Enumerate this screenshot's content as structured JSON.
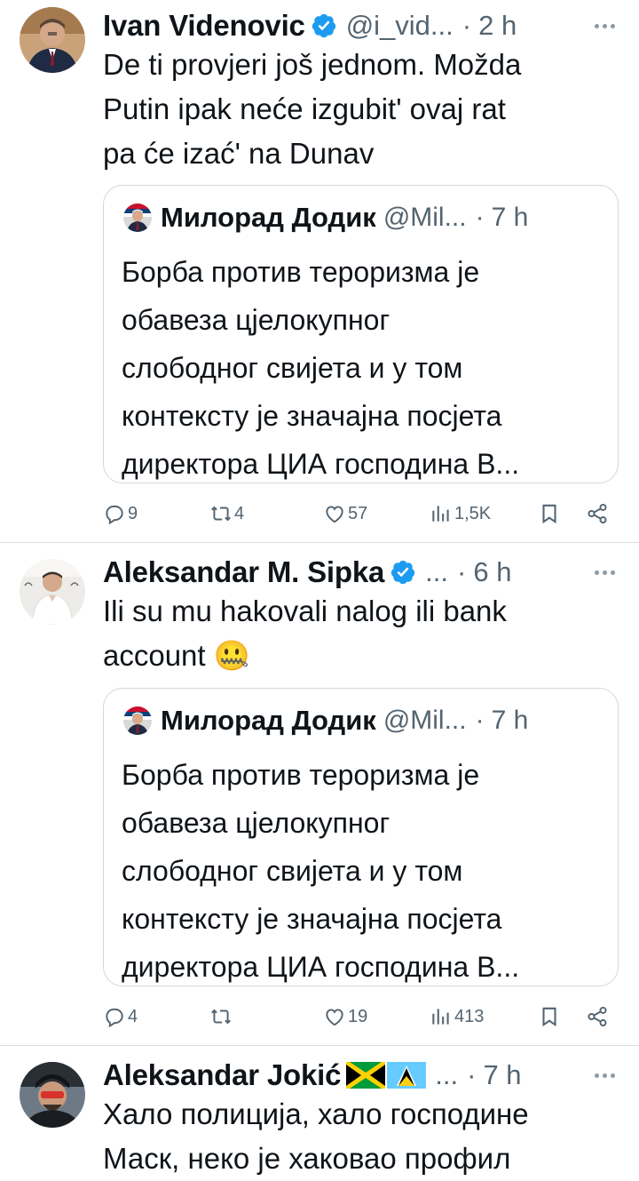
{
  "tweets": [
    {
      "author": "Ivan Videnovic",
      "handle": "@i_vid...",
      "dot": "·",
      "time": "2 h",
      "lines": [
        "De ti provjeri još jednom. Možda",
        "Putin ipak neće izgubit' ovaj rat",
        "pa će izać' na Dunav"
      ],
      "quote": {
        "author": "Милорад Додик",
        "handle": "@Mil...",
        "dot": "·",
        "time": "7 h",
        "lines": [
          "Борба против тероризма је",
          "обавеза цјелокупног",
          "слободног свијета и у том",
          "контексту је значајна посјета",
          "директора ЦИА господина В..."
        ]
      },
      "actions": {
        "replies": "9",
        "reposts": "4",
        "likes": "57",
        "views": "1,5K"
      }
    },
    {
      "author": "Aleksandar M. Sipka",
      "handle": "...",
      "dot": "·",
      "time": "6 h",
      "lines": [
        "Ili su mu hakovali nalog ili bank",
        "account"
      ],
      "emoji": "🤐",
      "quote": {
        "author": "Милорад Додик",
        "handle": "@Mil...",
        "dot": "·",
        "time": "7 h",
        "lines": [
          "Борба против тероризма је",
          "обавеза цјелокупног",
          "слободног свијета и у том",
          "контексту је значајна посјета",
          "директора ЦИА господина В..."
        ]
      },
      "actions": {
        "replies": "4",
        "reposts": "",
        "likes": "19",
        "views": "413"
      }
    },
    {
      "author": "Aleksandar Jokić",
      "handle": "...",
      "dot": "·",
      "time": "7 h",
      "lines": [
        "Хало полиција, хало господине",
        "Маск, неко је хаковао профил"
      ]
    }
  ],
  "colors": {
    "text": "#0f1419",
    "secondary": "#536471",
    "verified": "#1d9bf0",
    "border": "#cfd9de"
  },
  "icons": [
    "verified-badge-icon",
    "more-icon",
    "reply-icon",
    "repost-icon",
    "like-icon",
    "views-icon",
    "bookmark-icon",
    "share-icon",
    "jamaica-flag-icon",
    "saint-lucia-flag-icon"
  ]
}
